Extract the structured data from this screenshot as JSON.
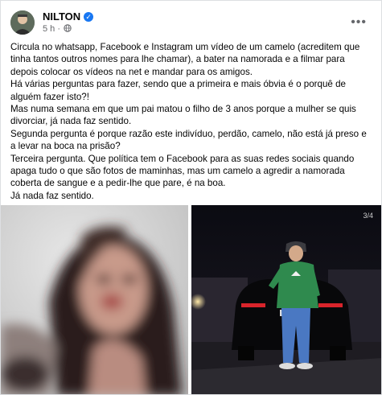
{
  "post": {
    "author": "NILTON",
    "time": "5 h",
    "separator": "·",
    "paragraphs": [
      "Circula no whatsapp, Facebook e Instagram um vídeo de um camelo (acreditem que tinha tantos outros nomes para lhe chamar), a bater na namorada e a filmar para depois colocar os vídeos na net e mandar para os amigos.",
      "Há várias perguntas para fazer, sendo que a primeira e mais óbvia é o porquê de alguém fazer isto?!",
      "Mas numa semana em que um pai matou o filho de 3 anos porque a mulher se quis divorciar, já nada faz sentido.",
      "Segunda pergunta é porque razão este indivíduo, perdão, camelo, não está já preso e a levar na boca na prisão?",
      "Terceira pergunta. Que política tem o Facebook para as suas redes sociais quando apaga tudo o que são fotos de maminhas, mas um camelo a agredir a namorada coberta de sangue e a pedir-lhe que pare, é na boa.",
      "Já nada faz sentido."
    ]
  },
  "media": {
    "counter": "3/4"
  },
  "icons": {
    "verified": "verified-badge-icon",
    "privacy": "globe-icon",
    "more": "more-options-icon"
  },
  "colors": {
    "verified": "#1877f2",
    "meta_text": "#65676b"
  }
}
